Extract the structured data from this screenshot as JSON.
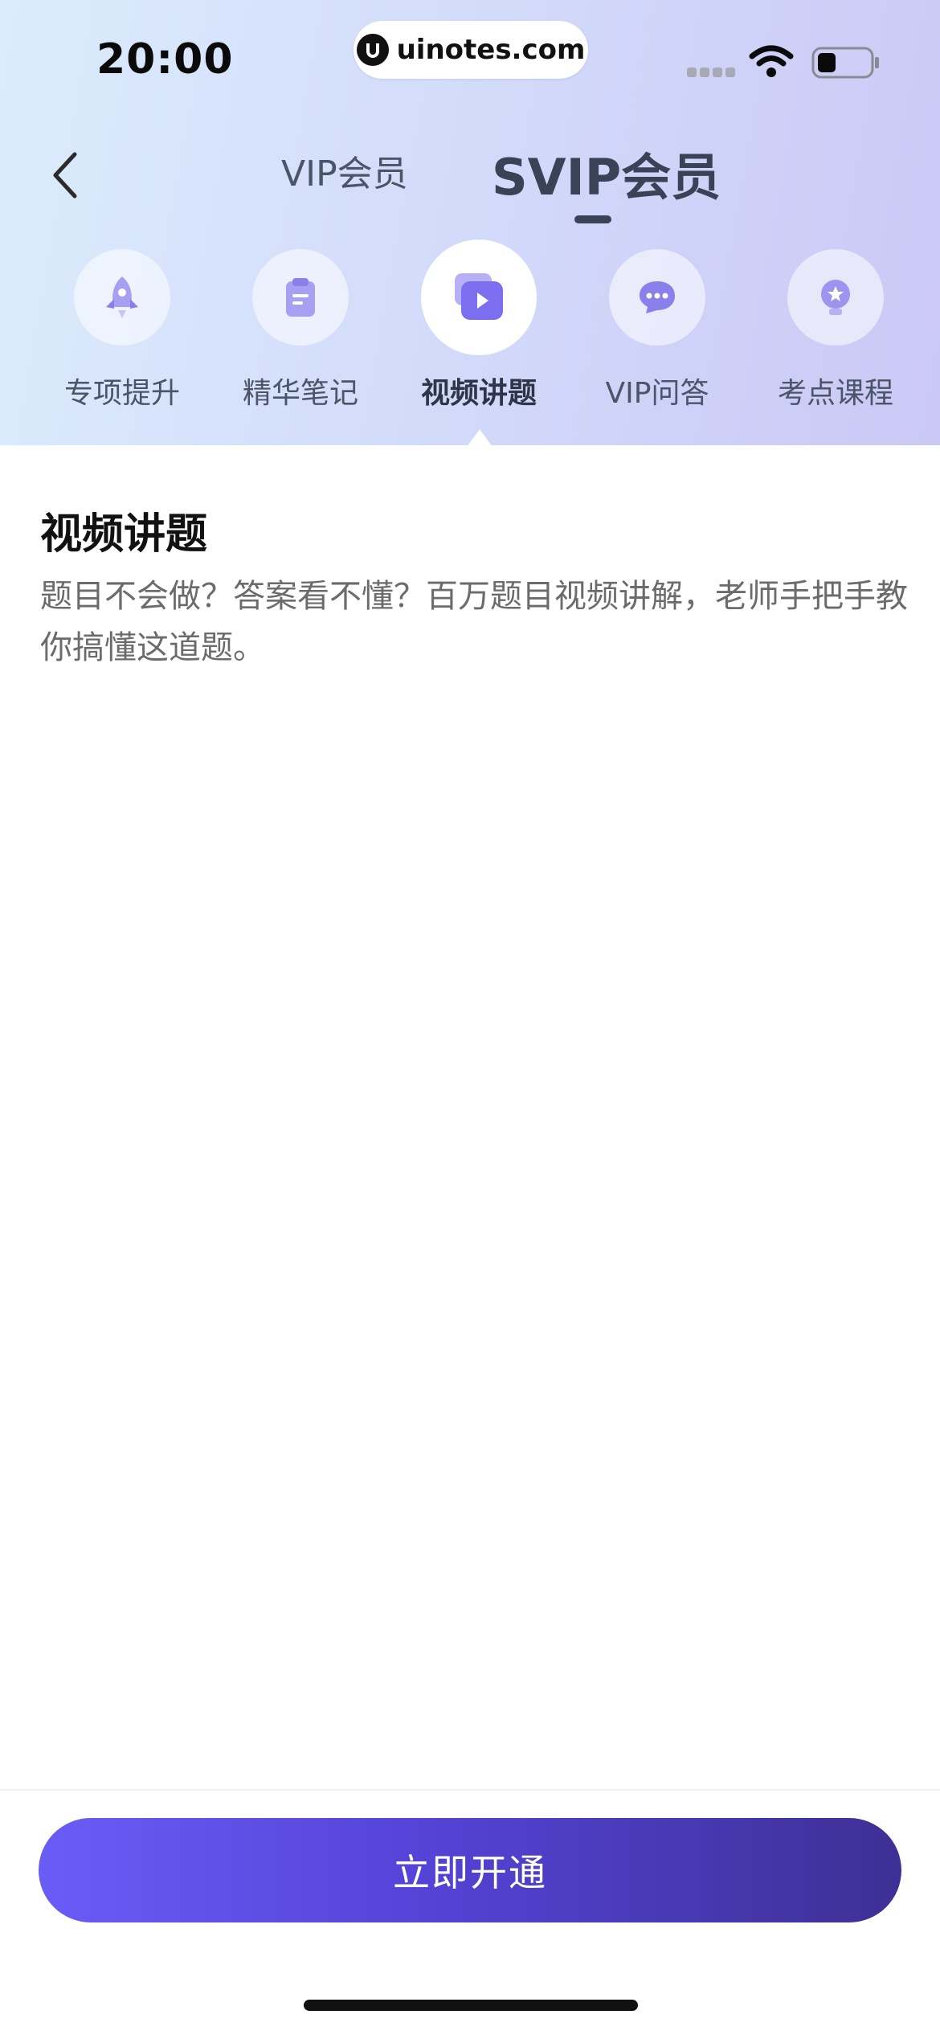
{
  "status_bar": {
    "time": "20:00",
    "watermark": "uinotes.com"
  },
  "nav": {
    "tabs": [
      {
        "label": "VIP会员",
        "active": false
      },
      {
        "label": "SVIP会员",
        "active": true
      }
    ]
  },
  "features": [
    {
      "label": "专项提升",
      "icon": "rocket-icon",
      "active": false
    },
    {
      "label": "精华笔记",
      "icon": "note-icon",
      "active": false
    },
    {
      "label": "视频讲题",
      "icon": "video-icon",
      "active": true
    },
    {
      "label": "VIP问答",
      "icon": "chat-icon",
      "active": false
    },
    {
      "label": "考点课程",
      "icon": "lightbulb-icon",
      "active": false
    }
  ],
  "content": {
    "title": "视频讲题",
    "description": "题目不会做？答案看不懂？百万题目视频讲解，老师手把手教你搞懂这道题。"
  },
  "cta": {
    "label": "立即开通"
  },
  "colors": {
    "accent": "#5b4ce6",
    "cta_gradient_start": "#6a5cf6",
    "cta_gradient_end": "#3e2f95",
    "text_primary": "#3a4256"
  }
}
